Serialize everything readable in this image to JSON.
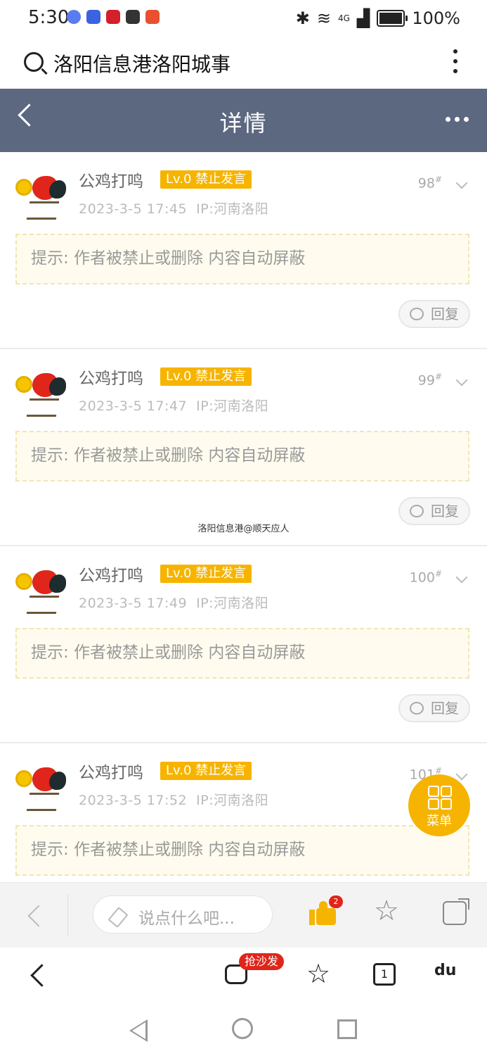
{
  "status": {
    "time": "5:30",
    "network": "4G",
    "battery": "100%",
    "battery_level": 1.0
  },
  "search": {
    "title": "洛阳信息港洛阳城事"
  },
  "header": {
    "title": "详情"
  },
  "posts": [
    {
      "name": "公鸡打鸣",
      "badge": "Lv.0 禁止发言",
      "floor": "98",
      "date": "2023-3-5 17:45",
      "ip": "IP:河南洛阳",
      "notice": "提示: 作者被禁止或删除 内容自动屏蔽",
      "reply": "回复"
    },
    {
      "name": "公鸡打鸣",
      "badge": "Lv.0 禁止发言",
      "floor": "99",
      "date": "2023-3-5 17:47",
      "ip": "IP:河南洛阳",
      "notice": "提示: 作者被禁止或删除 内容自动屏蔽",
      "reply": "回复"
    },
    {
      "name": "公鸡打鸣",
      "badge": "Lv.0 禁止发言",
      "floor": "100",
      "date": "2023-3-5 17:49",
      "ip": "IP:河南洛阳",
      "notice": "提示: 作者被禁止或删除 内容自动屏蔽",
      "reply": "回复"
    },
    {
      "name": "公鸡打鸣",
      "badge": "Lv.0 禁止发言",
      "floor": "101",
      "date": "2023-3-5 17:52",
      "ip": "IP:河南洛阳",
      "notice": "提示: 作者被禁止或删除 内容自动屏蔽",
      "reply": "回复"
    }
  ],
  "floor_suffix": "#",
  "watermark": "洛阳信息港@顺天应人",
  "fab": {
    "label": "菜单"
  },
  "comment_bar": {
    "placeholder": "说点什么吧...",
    "like_count": "2"
  },
  "browser_bar": {
    "sofa_label": "抢沙发",
    "tab_count": "1",
    "baidu": "du"
  },
  "colors": {
    "header_bg": "#5b6880",
    "accent": "#f6b400",
    "badge_red": "#e0251b"
  }
}
